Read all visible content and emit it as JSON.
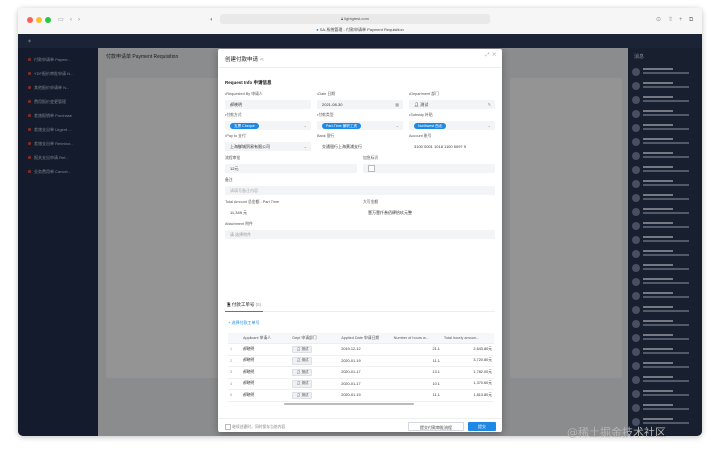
{
  "browser": {
    "url": "lightgtest.com",
    "tab_title": "SA-系统管理 - 付款申请单 Payment Requisition",
    "colors": {
      "close": "#ff5f57",
      "minimize": "#febc2e",
      "maximize": "#28c840"
    }
  },
  "background": {
    "page_title": "付款申请单 Payment Requisition",
    "sidebar_items": [
      "付款申请单 Payme...",
      "YDF报价审批申请 N...",
      "其他报价申请单 N...",
      "费用报价变更管理",
      "差旅报销单 Purchase",
      "差旅支出单 Urgent ...",
      "差旅支出单 Reimbur...",
      "报关支出申请 Ref...",
      "业务费用单 Cancel..."
    ],
    "right_panel_title": "消息"
  },
  "modal": {
    "title": "创建付款申请",
    "section_title": "Request Info 申请信息",
    "fields": {
      "requested_by": {
        "label": "•Requested By 申请人",
        "value": "郝晓明"
      },
      "date": {
        "label": "•Date 日期",
        "value": "2021-08-30"
      },
      "department": {
        "label": "•Department 部门",
        "value": "测试"
      },
      "payment_method": {
        "label": "•付款方式",
        "value": "支票 Cheque"
      },
      "payment_type": {
        "label": "•付款类型",
        "value": "Part-Time 兼职工资"
      },
      "subsidy": {
        "label": "•Subsidy 补贴",
        "value": "Northwest 西北"
      },
      "pay_to": {
        "label": "•Pay to 支付",
        "value": "上海御城贸易有限公司"
      },
      "bank": {
        "label": "Bank 银行",
        "value": "交通银行上海黄浦支行"
      },
      "account": {
        "label": "Account 账号",
        "value": "3100 0001 1018 1100 5097 9"
      },
      "approval_no": {
        "label": "流程审批",
        "value": "12元"
      },
      "urgent": {
        "label": "加急标识"
      },
      "remarks": {
        "label": "备注",
        "placeholder": "请填写备注内容"
      },
      "total": {
        "label": "Total Amount 总金额 - Part Time",
        "value": "11,349 元"
      },
      "capital": {
        "label": "大写金额",
        "value": "壹万壹仟叁佰肆拾玖元整"
      },
      "attachment": {
        "label": "Attachment 附件",
        "placeholder": "请 选择附件"
      }
    },
    "tab": {
      "label": "付款工单号",
      "count": "(5)"
    },
    "add_link": "+ 选择付款工单号",
    "table": {
      "columns": [
        "",
        "Applicant 申请人",
        "Dept 申请部门",
        "Applied Date 申请日期",
        "Number of hours w...",
        "Total hourly amoun..."
      ],
      "rows": [
        {
          "idx": "1",
          "name": "郝晓明",
          "dept": "测试",
          "date": "2019-12-12",
          "hours": "21.1",
          "amount": "2,643.80元"
        },
        {
          "idx": "2",
          "name": "郝晓明",
          "dept": "测试",
          "date": "2020-01-19",
          "hours": "11.1",
          "amount": "3,720.80元"
        },
        {
          "idx": "3",
          "name": "郝晓明",
          "dept": "测试",
          "date": "2020-01-17",
          "hours": "13.1",
          "amount": "1,782.00元"
        },
        {
          "idx": "4",
          "name": "郝晓明",
          "dept": "测试",
          "date": "2020-01-17",
          "hours": "10.1",
          "amount": "1,370.60元"
        },
        {
          "idx": "5",
          "name": "郝晓明",
          "dept": "测试",
          "date": "2020-01-19",
          "hours": "11.1",
          "amount": "1,813.80元"
        }
      ]
    },
    "footer": {
      "checkbox_label": "继续创建时，同时保存当前内容",
      "secondary": "提交付款审批流程",
      "primary": "提交"
    }
  },
  "watermark": "@稀土掘金技术社区"
}
